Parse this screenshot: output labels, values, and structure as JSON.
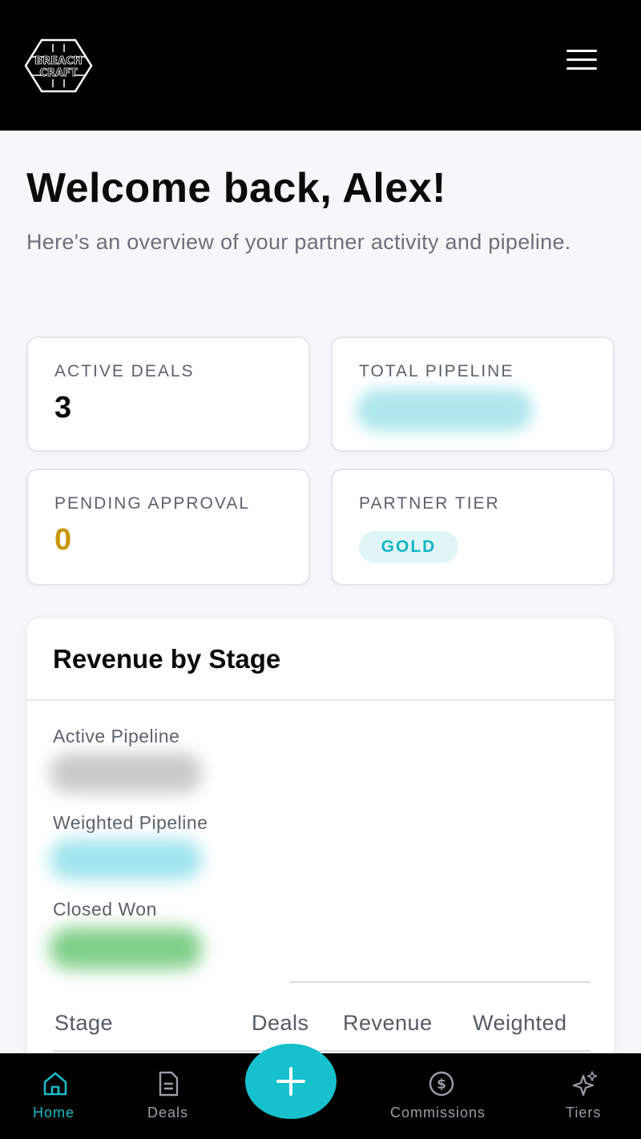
{
  "header": {
    "logo_text_top": "BREACH",
    "logo_text_bottom": "CRAFT"
  },
  "welcome": {
    "title": "Welcome back, Alex!",
    "subtitle": "Here's an overview of your partner activity and pipeline."
  },
  "stats": {
    "active_deals": {
      "label": "ACTIVE DEALS",
      "value": "3"
    },
    "total_pipeline": {
      "label": "TOTAL PIPELINE"
    },
    "pending_approval": {
      "label": "PENDING APPROVAL",
      "value": "0"
    },
    "partner_tier": {
      "label": "PARTNER TIER",
      "value": "GOLD"
    }
  },
  "revenue": {
    "title": "Revenue by Stage",
    "active_pipeline_label": "Active Pipeline",
    "weighted_pipeline_label": "Weighted Pipeline",
    "closed_won_label": "Closed Won",
    "table_headers": [
      "Stage",
      "Deals",
      "Revenue",
      "Weighted"
    ]
  },
  "nav": {
    "home": "Home",
    "deals": "Deals",
    "commissions": "Commissions",
    "tiers": "Tiers"
  },
  "colors": {
    "accent": "#16c0cc",
    "pending": "#c9960d",
    "tier_badge_bg": "#dff5f6"
  }
}
